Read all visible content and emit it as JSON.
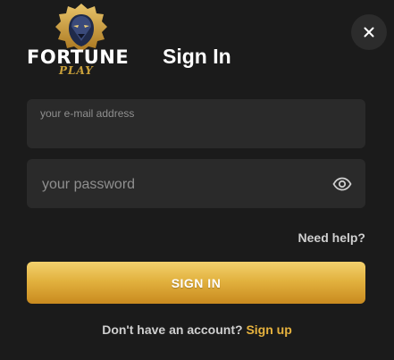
{
  "brand": {
    "name": "FORTUNE",
    "sub": "PLAY",
    "logo_icon": "lion-icon"
  },
  "dialog": {
    "title": "Sign In",
    "close_icon": "close-icon"
  },
  "email": {
    "label": "your e-mail address",
    "value": ""
  },
  "password": {
    "placeholder": "your password",
    "value": "",
    "toggle_icon": "eye-icon"
  },
  "links": {
    "need_help": "Need help?"
  },
  "buttons": {
    "sign_in": "SIGN IN"
  },
  "footer": {
    "prompt": "Don't have an account?",
    "signup_link": "Sign up"
  },
  "colors": {
    "background": "#1b1b1b",
    "field_bg": "#2a2a2a",
    "accent_gold": "#e6b23e",
    "button_gradient_top": "#f3d16e",
    "button_gradient_bottom": "#c98a1f"
  }
}
